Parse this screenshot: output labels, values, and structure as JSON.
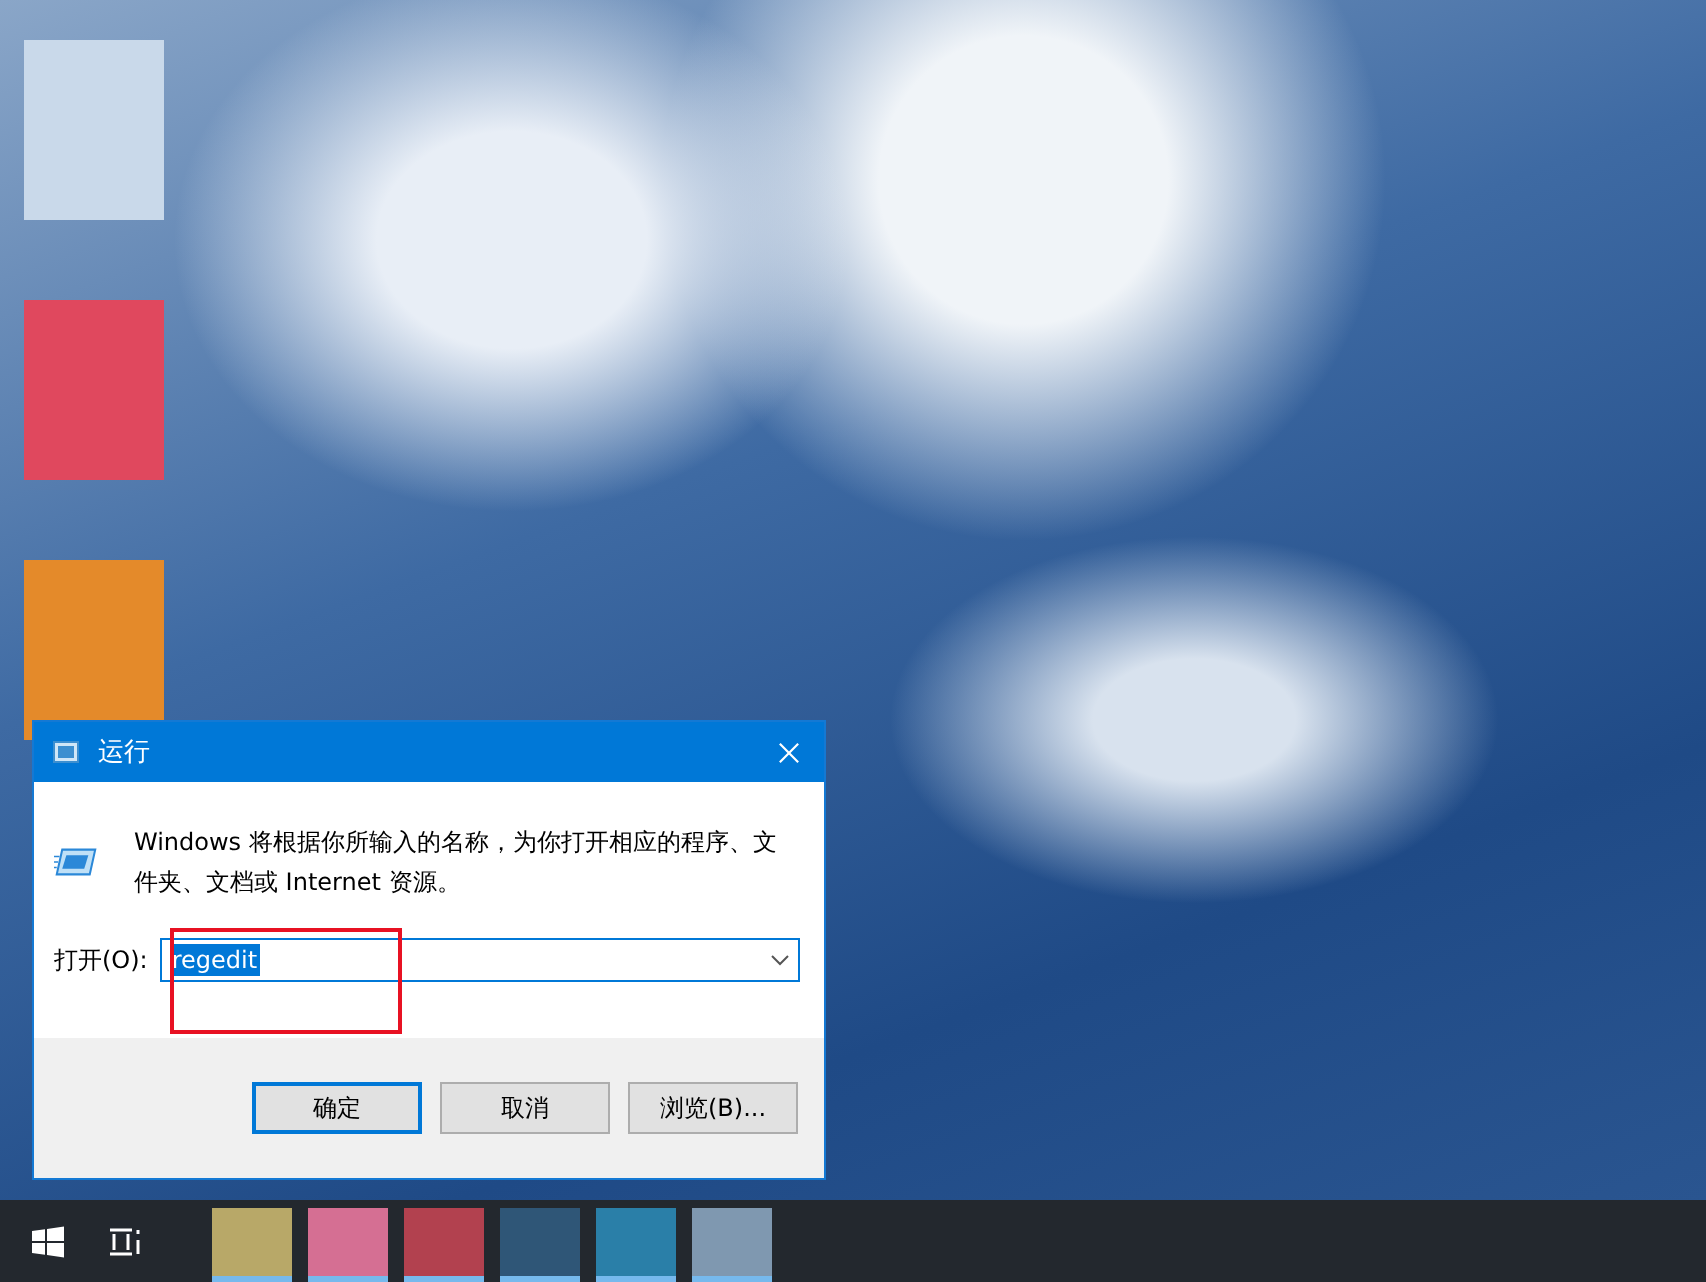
{
  "desktop": {
    "icons": [
      {
        "color": "#c9d9ea"
      },
      {
        "color": "#e0485e"
      },
      {
        "color": "#e48a2a"
      }
    ]
  },
  "dialog": {
    "title": "运行",
    "description": "Windows 将根据你所输入的名称，为你打开相应的程序、文件夹、文档或 Internet 资源。",
    "open_label": "打开(O):",
    "input": {
      "value": "regedit",
      "selected": true
    },
    "buttons": [
      {
        "label": "确定",
        "default": true
      },
      {
        "label": "取消",
        "default": false
      },
      {
        "label": "浏览(B)...",
        "default": false
      }
    ]
  },
  "taskbar": {
    "apps": [
      {
        "color": "#b8a868",
        "running": true
      },
      {
        "color": "#d56f93",
        "running": true
      },
      {
        "color": "#b2414f",
        "running": true
      },
      {
        "color": "#2f5677",
        "running": true
      },
      {
        "color": "#2a7fa8",
        "running": true
      },
      {
        "color": "#7f98b0",
        "running": true
      }
    ]
  }
}
